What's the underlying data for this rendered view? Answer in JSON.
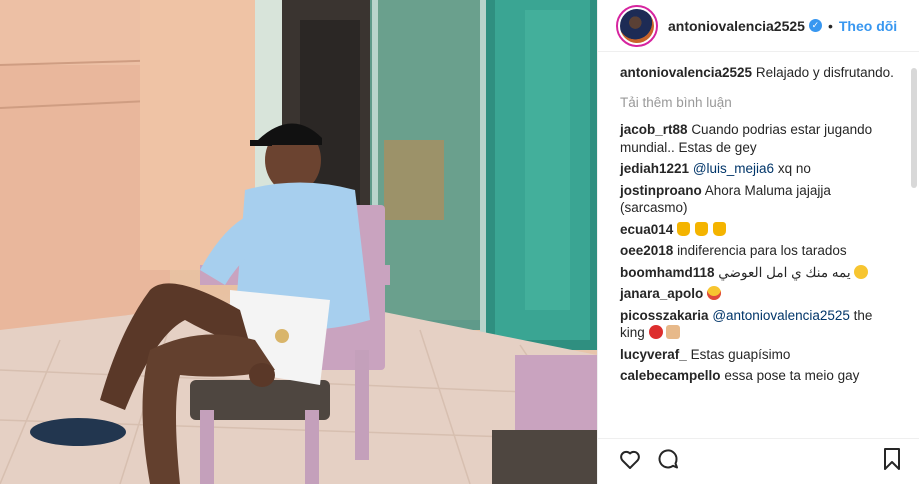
{
  "header": {
    "username": "antoniovalencia2525",
    "separator": "•",
    "follow_label": "Theo dõi",
    "verified_mark": "✓"
  },
  "caption": {
    "username": "antoniovalencia2525",
    "text": "Relajado y disfrutando."
  },
  "load_more_label": "Tải thêm bình luận",
  "comments": [
    {
      "username": "jacob_rt88",
      "text": "Cuando podrias estar jugando mundial.. Estas de gey"
    },
    {
      "username": "jediah1221",
      "mention": "@luis_mejia6",
      "text": " xq no"
    },
    {
      "username": "jostinproano",
      "text": "Ahora Maluma jajajja (sarcasmo)"
    },
    {
      "username": "ecua014",
      "text": ""
    },
    {
      "username": "oee2018",
      "text": "indiferencia para los tarados"
    },
    {
      "username": "boomhamd118",
      "text": "يمه منك ي امل العوضي"
    },
    {
      "username": "janara_apolo",
      "text": ""
    },
    {
      "username": "picosszakaria",
      "mention": "@antoniovalencia2525",
      "text": " the king"
    },
    {
      "username": "lucyveraf_",
      "text": "Estas guapísimo"
    },
    {
      "username": "calebecampello",
      "text": "essa pose ta meio gay"
    }
  ],
  "icons": {
    "like": "heart-icon",
    "comment": "comment-icon",
    "save": "bookmark-icon"
  },
  "colors": {
    "link": "#3897f0",
    "mention": "#003569",
    "muted": "#999999"
  }
}
